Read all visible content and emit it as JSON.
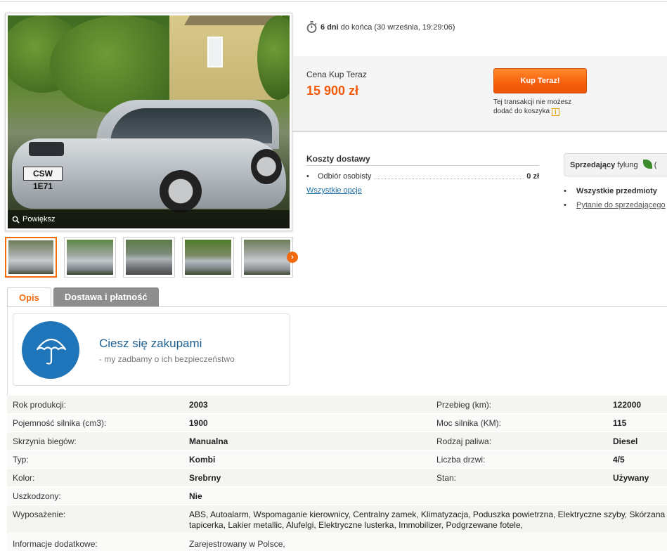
{
  "gallery": {
    "zoom_label": "Powiększ",
    "plate_text": "CSW 1E71",
    "thumbnail_count": 5
  },
  "auction": {
    "time_left_bold": "6 dni",
    "time_left_rest": "do końca (30 września, 19:29:06)"
  },
  "buy_now": {
    "label": "Cena Kup Teraz",
    "price": "15 900 zł",
    "button": "Kup Teraz!",
    "note": "Tej transakcji nie możesz dodać do koszyka"
  },
  "shipping": {
    "title": "Koszty dostawy",
    "option_name": "Odbiór osobisty",
    "option_price": "0 zł",
    "all_options": "Wszystkie opcje"
  },
  "seller": {
    "label": "Sprzedający",
    "name": "fylung",
    "paren": "(",
    "all_items": "Wszystkie przedmioty",
    "question": "Pytanie do sprzedającego"
  },
  "tabs": {
    "description": "Opis",
    "delivery": "Dostawa i płatność"
  },
  "promo": {
    "title": "Ciesz się zakupami",
    "subtitle": "-   my zadbamy o ich bezpieczeństwo"
  },
  "params": {
    "year_label": "Rok produkcji:",
    "year_value": "2003",
    "mileage_label": "Przebieg (km):",
    "mileage_value": "122000",
    "engine_label": "Pojemność silnika (cm3):",
    "engine_value": "1900",
    "power_label": "Moc silnika (KM):",
    "power_value": "115",
    "gearbox_label": "Skrzynia biegów:",
    "gearbox_value": "Manualna",
    "fuel_label": "Rodzaj paliwa:",
    "fuel_value": "Diesel",
    "type_label": "Typ:",
    "type_value": "Kombi",
    "doors_label": "Liczba drzwi:",
    "doors_value": "4/5",
    "color_label": "Kolor:",
    "color_value": "Srebrny",
    "state_label": "Stan:",
    "state_value": "Używany",
    "damaged_label": "Uszkodzony:",
    "damaged_value": "Nie",
    "equipment_label": "Wyposażenie:",
    "equipment_value": "ABS, Autoalarm, Wspomaganie kierownicy, Centralny zamek, Klimatyzacja, Poduszka powietrzna, Elektryczne szyby, Skórzana tapicerka, Lakier metallic, Alufelgi, Elektryczne lusterka, Immobilizer, Podgrzewane fotele,",
    "extra_label": "Informacje dodatkowe:",
    "extra_value": "Zarejestrowany w Polsce,"
  },
  "colors": {
    "accent_orange": "#f26a10",
    "price_orange": "#f25a0c",
    "link_blue": "#1d6fa5",
    "promo_blue": "#1f75b9"
  }
}
